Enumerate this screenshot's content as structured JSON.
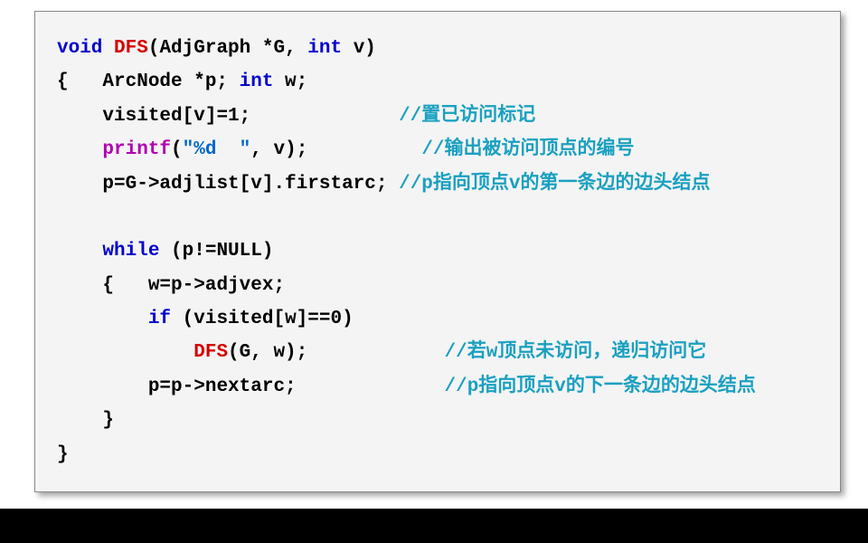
{
  "code": {
    "l01_void": "void",
    "l01_dfs": "DFS",
    "l01_open": "(AdjGraph *G, ",
    "l01_int": "int",
    "l01_v": " v)",
    "l02a": "{   ArcNode *p; ",
    "l02_int": "int",
    "l02b": " w;",
    "l03_pad": "    ",
    "l03": "visited[v]=1;",
    "l03_gap": "             ",
    "l03_cmt": "//置已访问标记",
    "l04_pad": "    ",
    "l04_printf": "printf",
    "l04_open": "(",
    "l04_str": "\"%d  \"",
    "l04_rest": ", v);",
    "l04_gap": "          ",
    "l04_cmt": "//输出被访问顶点的编号",
    "l05_pad": "    ",
    "l05": "p=G->adjlist[v].firstarc;",
    "l05_gap": " ",
    "l05_cmt": "//p指向顶点v的第一条边的边头结点",
    "l06_blank": " ",
    "l07_pad": "    ",
    "l07_while": "while",
    "l07_rest": " (p!=NULL)",
    "l08_pad": "    ",
    "l08": "{   w=p->adjvex;",
    "l09_pad": "        ",
    "l09_if": "if",
    "l09_rest": " (visited[w]==0)",
    "l10_pad": "            ",
    "l10_dfs": "DFS",
    "l10_rest": "(G, w);",
    "l10_gap": "            ",
    "l10_cmt": "//若w顶点未访问，递归访问它",
    "l11_pad": "        ",
    "l11": "p=p->nextarc;",
    "l11_gap": "             ",
    "l11_cmt": "//p指向顶点v的下一条边的边头结点",
    "l12_pad": "    ",
    "l12": "}",
    "l13": "}"
  }
}
